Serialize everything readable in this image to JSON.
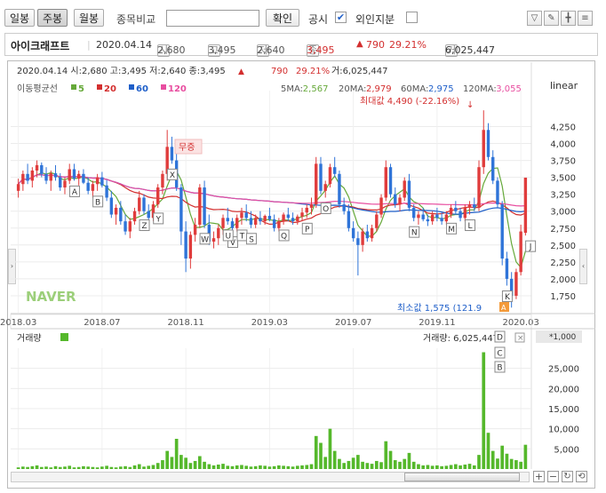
{
  "toolbar": {
    "period_daily": "일봉",
    "period_weekly": "주봉",
    "period_monthly": "월봉",
    "compare_label": "종목비교",
    "confirm_button": "확인",
    "disclosure_label": "공시",
    "foreign_label": "외인지분",
    "disclosure_checked": true,
    "foreign_checked": false
  },
  "info": {
    "stock_name": "아이크래프트",
    "date": "2020.04.14",
    "open": "2,680",
    "high": "3,495",
    "low": "2,640",
    "close": "3,495",
    "change": "790",
    "change_pct": "29.21%",
    "volume": "6,025,447"
  },
  "chart_data": {
    "type": "candlestick",
    "header_text": "2020.04.14 시:2,680 고:3,495 저:2,640 종:3,495",
    "header_change": "790",
    "header_pct": "29.21%",
    "header_volume": "거:6,025,447",
    "ma_legend_title": "이동평균선",
    "ma_legend": [
      {
        "label": "5",
        "color": "#66a93a"
      },
      {
        "label": "20",
        "color": "#d32f2f"
      },
      {
        "label": "60",
        "color": "#1f5fc9"
      },
      {
        "label": "120",
        "color": "#e84ea0"
      }
    ],
    "ma_values": [
      {
        "label": "5MA:",
        "value": "2,567",
        "color": "#66a93a"
      },
      {
        "label": "20MA:",
        "value": "2,979",
        "color": "#d32f2f"
      },
      {
        "label": "60MA:",
        "value": "2,975",
        "color": "#1f5fc9"
      },
      {
        "label": "120MA:",
        "value": "3,055",
        "color": "#e84ea0"
      }
    ],
    "scale_label": "linear",
    "y_ticks": [
      1750,
      2000,
      2250,
      2500,
      2750,
      3000,
      3250,
      3500,
      3750,
      4000,
      4250
    ],
    "y_tick_labels": [
      "1,750",
      "2,000",
      "2,250",
      "2,500",
      "2,750",
      "3,000",
      "3,250",
      "3,500",
      "3,750",
      "4,000",
      "4,250"
    ],
    "ylim": [
      1500,
      4650
    ],
    "x_labels": [
      "2018.03",
      "2018.07",
      "2018.11",
      "2019.03",
      "2019.07",
      "2019.11",
      "2020.03"
    ],
    "max_label": "최대값 4,490 (-22.16%)",
    "min_label": "최소값 1,575 (121.9",
    "max_value": 4490,
    "min_value": 1575,
    "annotation_text": "무증",
    "watermark": "NAVER",
    "event_markers": [
      "B",
      "A",
      "Z",
      "Y",
      "X",
      "W",
      "V",
      "U",
      "T",
      "S",
      "Q",
      "P",
      "O",
      "N",
      "M",
      "L",
      "K",
      "J"
    ],
    "candles": [
      [
        3300,
        3480,
        3200,
        3400
      ],
      [
        3400,
        3600,
        3300,
        3550
      ],
      [
        3550,
        3700,
        3400,
        3450
      ],
      [
        3450,
        3650,
        3350,
        3600
      ],
      [
        3600,
        3750,
        3500,
        3680
      ],
      [
        3680,
        3720,
        3500,
        3550
      ],
      [
        3550,
        3650,
        3400,
        3450
      ],
      [
        3450,
        3600,
        3300,
        3560
      ],
      [
        3560,
        3680,
        3450,
        3500
      ],
      [
        3500,
        3560,
        3300,
        3350
      ],
      [
        3350,
        3500,
        3250,
        3450
      ],
      [
        3450,
        3700,
        3400,
        3620
      ],
      [
        3620,
        3700,
        3450,
        3480
      ],
      [
        3480,
        3600,
        3380,
        3550
      ],
      [
        3550,
        3620,
        3400,
        3420
      ],
      [
        3420,
        3500,
        3250,
        3300
      ],
      [
        3300,
        3450,
        3200,
        3400
      ],
      [
        3400,
        3550,
        3300,
        3500
      ],
      [
        3500,
        3580,
        3350,
        3380
      ],
      [
        3380,
        3460,
        3150,
        3200
      ],
      [
        3200,
        3300,
        2900,
        2950
      ],
      [
        2950,
        3100,
        2800,
        3050
      ],
      [
        3050,
        3150,
        2800,
        2850
      ],
      [
        2850,
        2950,
        2650,
        2700
      ],
      [
        2700,
        2900,
        2600,
        2850
      ],
      [
        2850,
        3050,
        2800,
        3000
      ],
      [
        3000,
        3300,
        2950,
        3200
      ],
      [
        3200,
        3250,
        2950,
        3000
      ],
      [
        3000,
        3100,
        2850,
        2900
      ],
      [
        2900,
        3150,
        2850,
        3100
      ],
      [
        3100,
        3400,
        3050,
        3350
      ],
      [
        3350,
        3600,
        3250,
        3550
      ],
      [
        3550,
        4200,
        3450,
        3950
      ],
      [
        3950,
        4100,
        3700,
        3750
      ],
      [
        3750,
        3900,
        3300,
        3350
      ],
      [
        3350,
        3400,
        2500,
        2700
      ],
      [
        2700,
        2850,
        2100,
        2300
      ],
      [
        2300,
        2700,
        2150,
        2650
      ],
      [
        2650,
        2900,
        2550,
        2800
      ],
      [
        2800,
        3400,
        2750,
        3350
      ],
      [
        3350,
        3450,
        2750,
        2800
      ],
      [
        2800,
        2950,
        2500,
        2550
      ],
      [
        2550,
        2700,
        2450,
        2600
      ],
      [
        2600,
        2800,
        2500,
        2750
      ],
      [
        2750,
        2950,
        2650,
        2900
      ],
      [
        2900,
        3050,
        2800,
        2850
      ],
      [
        2850,
        2900,
        2700,
        2750
      ],
      [
        2750,
        2950,
        2700,
        2900
      ],
      [
        2900,
        3050,
        2800,
        2980
      ],
      [
        2980,
        3100,
        2850,
        2900
      ],
      [
        2900,
        3000,
        2750,
        2800
      ],
      [
        2800,
        2950,
        2750,
        2900
      ],
      [
        2900,
        3000,
        2800,
        2850
      ],
      [
        2850,
        2950,
        2800,
        2930
      ],
      [
        2930,
        3050,
        2850,
        2880
      ],
      [
        2880,
        2950,
        2700,
        2750
      ],
      [
        2750,
        2900,
        2700,
        2850
      ],
      [
        2850,
        2980,
        2800,
        2950
      ],
      [
        2950,
        3050,
        2850,
        2900
      ],
      [
        2900,
        2980,
        2800,
        2850
      ],
      [
        2850,
        2950,
        2800,
        2920
      ],
      [
        2920,
        3050,
        2850,
        2980
      ],
      [
        2980,
        3100,
        2900,
        3050
      ],
      [
        3050,
        3200,
        2950,
        3100
      ],
      [
        3100,
        3800,
        3050,
        3700
      ],
      [
        3700,
        3800,
        3250,
        3300
      ],
      [
        3300,
        3450,
        3200,
        3400
      ],
      [
        3400,
        3700,
        3350,
        3650
      ],
      [
        3650,
        3800,
        3500,
        3550
      ],
      [
        3550,
        3600,
        3050,
        3100
      ],
      [
        3100,
        3200,
        2950,
        3000
      ],
      [
        3000,
        3100,
        2700,
        2750
      ],
      [
        2750,
        2850,
        2550,
        2600
      ],
      [
        2600,
        2700,
        2050,
        2500
      ],
      [
        2500,
        2750,
        2400,
        2700
      ],
      [
        2700,
        2800,
        2550,
        2600
      ],
      [
        2600,
        2800,
        2550,
        2750
      ],
      [
        2750,
        3000,
        2700,
        2950
      ],
      [
        2950,
        3250,
        2900,
        3200
      ],
      [
        3200,
        3750,
        3150,
        3650
      ],
      [
        3650,
        3700,
        3200,
        3250
      ],
      [
        3250,
        3350,
        3050,
        3100
      ],
      [
        3100,
        3250,
        3000,
        3200
      ],
      [
        3200,
        3500,
        3150,
        3450
      ],
      [
        3450,
        3550,
        3000,
        3050
      ],
      [
        3050,
        3100,
        2850,
        2900
      ],
      [
        2900,
        3000,
        2800,
        2950
      ],
      [
        2950,
        3050,
        2850,
        2880
      ],
      [
        2880,
        2950,
        2780,
        2850
      ],
      [
        2850,
        3000,
        2800,
        2950
      ],
      [
        2950,
        3050,
        2850,
        2900
      ],
      [
        2900,
        2980,
        2800,
        2850
      ],
      [
        2850,
        3000,
        2800,
        2950
      ],
      [
        2950,
        3100,
        2900,
        3050
      ],
      [
        3050,
        3150,
        2950,
        3000
      ],
      [
        3000,
        3050,
        2850,
        2900
      ],
      [
        2900,
        3100,
        2850,
        3050
      ],
      [
        3050,
        3150,
        2950,
        3100
      ],
      [
        3100,
        3200,
        3000,
        3050
      ],
      [
        3050,
        3750,
        3000,
        3650
      ],
      [
        3650,
        4490,
        3550,
        4200
      ],
      [
        4200,
        4300,
        3750,
        3800
      ],
      [
        3800,
        3900,
        3400,
        3450
      ],
      [
        3450,
        3500,
        3050,
        3100
      ],
      [
        3100,
        3150,
        2200,
        2300
      ],
      [
        2300,
        2400,
        1900,
        2000
      ],
      [
        2000,
        2100,
        1575,
        1750
      ],
      [
        1750,
        2150,
        1700,
        2100
      ],
      [
        2100,
        2800,
        2050,
        2700
      ],
      [
        2680,
        3495,
        2640,
        3495
      ]
    ],
    "volume": {
      "label": "거래량",
      "value_label": "거래량: 6,025,447",
      "unit": "*1,000",
      "y_ticks": [
        5000,
        10000,
        15000,
        20000,
        25000
      ],
      "y_tick_labels": [
        "5,000",
        "10,000",
        "15,000",
        "20,000",
        "25,000"
      ],
      "ylim": [
        0,
        30000
      ],
      "values": [
        400,
        600,
        500,
        700,
        900,
        500,
        600,
        400,
        700,
        500,
        600,
        800,
        400,
        500,
        700,
        600,
        500,
        400,
        600,
        800,
        500,
        400,
        600,
        700,
        500,
        900,
        1200,
        600,
        800,
        1000,
        1500,
        2200,
        4500,
        3000,
        7500,
        3500,
        2800,
        1500,
        2000,
        3200,
        1800,
        1200,
        900,
        1100,
        1300,
        800,
        700,
        900,
        1000,
        800,
        600,
        700,
        900,
        800,
        600,
        700,
        900,
        800,
        700,
        600,
        800,
        900,
        1000,
        1200,
        8200,
        6500,
        3000,
        10000,
        4500,
        2500,
        1500,
        2000,
        2800,
        3500,
        1800,
        1500,
        1300,
        2000,
        1700,
        6900,
        4500,
        2200,
        1800,
        2500,
        4000,
        1800,
        1200,
        900,
        1000,
        800,
        900,
        700,
        800,
        1000,
        1200,
        900,
        1100,
        1300,
        900,
        3500,
        29000,
        9000,
        4500,
        2600,
        5800,
        3800,
        2500,
        2200,
        1800,
        6025
      ]
    }
  }
}
